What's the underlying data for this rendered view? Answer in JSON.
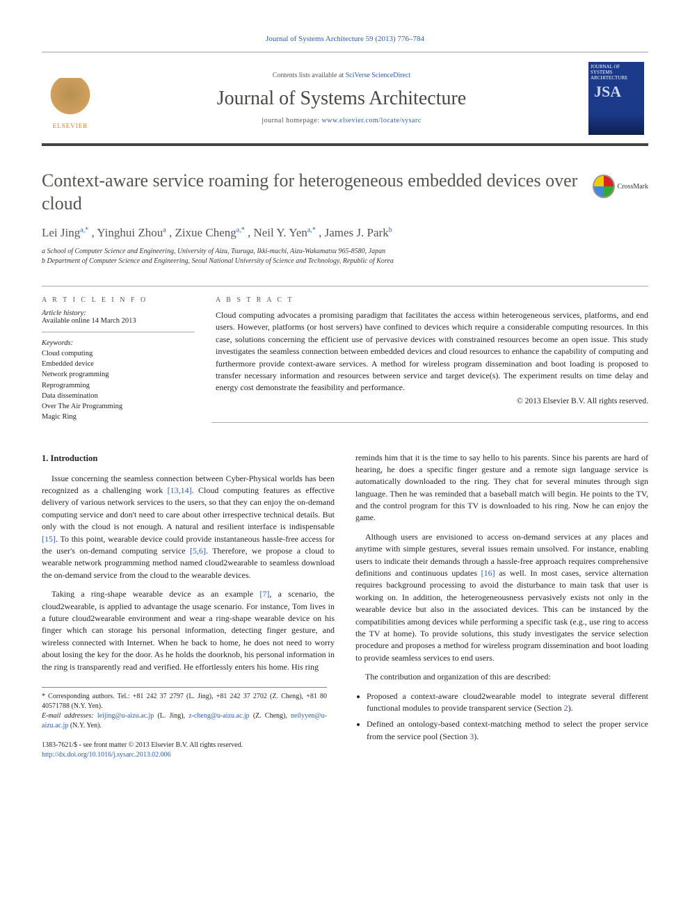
{
  "header": {
    "citation": "Journal of Systems Architecture 59 (2013) 776–784",
    "contents_prefix": "Contents lists available at ",
    "contents_link": "SciVerse ScienceDirect",
    "journal_title": "Journal of Systems Architecture",
    "homepage_prefix": "journal homepage: ",
    "homepage_link": "www.elsevier.com/locate/sysarc",
    "publisher": "ELSEVIER",
    "cover_small": "JOURNAL OF SYSTEMS ARCHITECTURE",
    "cover_big": "JSA"
  },
  "title": "Context-aware service roaming for heterogeneous embedded devices over cloud",
  "crossmark": "CrossMark",
  "authors_html": "Lei Jing",
  "authors": {
    "a1_name": "Lei Jing",
    "a1_sup": "a,*",
    "a2_name": ", Yinghui Zhou",
    "a2_sup": "a",
    "a3_name": ", Zixue Cheng",
    "a3_sup": "a,*",
    "a4_name": ", Neil Y. Yen",
    "a4_sup": "a,*",
    "a5_name": ", James J. Park",
    "a5_sup": "b"
  },
  "affiliations": {
    "a": "a School of Computer Science and Engineering, University of Aizu, Tsuruga, Ikki-machi, Aizu-Wakamatsu 965-8580, Japan",
    "b": "b Department of Computer Science and Engineering, Seoul National University of Science and Technology, Republic of Korea"
  },
  "info": {
    "label": "A R T I C L E   I N F O",
    "history_label": "Article history:",
    "history_line": "Available online 14 March 2013",
    "keywords_label": "Keywords:",
    "keywords": [
      "Cloud computing",
      "Embedded device",
      "Network programming",
      "Reprogramming",
      "Data dissemination",
      "Over The Air Programming",
      "Magic Ring"
    ]
  },
  "abstract": {
    "label": "A B S T R A C T",
    "text": "Cloud computing advocates a promising paradigm that facilitates the access within heterogeneous services, platforms, and end users. However, platforms (or host servers) have confined to devices which require a considerable computing resources. In this case, solutions concerning the efficient use of pervasive devices with constrained resources become an open issue. This study investigates the seamless connection between embedded devices and cloud resources to enhance the capability of computing and furthermore provide context-aware services. A method for wireless program dissemination and boot loading is proposed to transfer necessary information and resources between service and target device(s). The experiment results on time delay and energy cost demonstrate the feasibility and performance.",
    "copyright": "© 2013 Elsevier B.V. All rights reserved."
  },
  "body": {
    "sec1_heading": "1. Introduction",
    "col1_p1_a": "Issue concerning the seamless connection between Cyber-Physical worlds has been recognized as a challenging work ",
    "col1_p1_ref1": "[13,14]",
    "col1_p1_b": ". Cloud computing features as effective delivery of various network services to the users, so that they can enjoy the on-demand computing service and don't need to care about other irrespective technical details. But only with the cloud is not enough. A natural and resilient interface is indispensable ",
    "col1_p1_ref2": "[15]",
    "col1_p1_c": ". To this point, wearable device could provide instantaneous hassle-free access for the user's on-demand computing service ",
    "col1_p1_ref3": "[5,6]",
    "col1_p1_d": ". Therefore, we propose a cloud to wearable network programming method named cloud2wearable to seamless download the on-demand service from the cloud to the wearable devices.",
    "col1_p2_a": "Taking a ring-shape wearable device as an example ",
    "col1_p2_ref1": "[7]",
    "col1_p2_b": ", a scenario, the cloud2wearable, is applied to advantage the usage scenario. For instance, Tom lives in a future cloud2wearable environment and wear a ring-shape wearable device on his finger which can storage his personal information, detecting finger gesture, and wireless connected with Internet. When he back to home, he does not need to worry about losing the key for the door. As he holds the doorknob, his personal information in the ring is transparently read and verified. He effortlessly enters his home. His ring",
    "col2_p1": "reminds him that it is the time to say hello to his parents. Since his parents are hard of hearing, he does a specific finger gesture and a remote sign language service is automatically downloaded to the ring. They chat for several minutes through sign language. Then he was reminded that a baseball match will begin. He points to the TV, and the control program for this TV is downloaded to his ring. Now he can enjoy the game.",
    "col2_p2_a": "Although users are envisioned to access on-demand services at any places and anytime with simple gestures, several issues remain unsolved. For instance, enabling users to indicate their demands through a hassle-free approach requires comprehensive definitions and continuous updates ",
    "col2_p2_ref1": "[16]",
    "col2_p2_b": " as well. In most cases, service alternation requires background processing to avoid the disturbance to main task that user is working on. In addition, the heterogeneousness pervasively exists not only in the wearable device but also in the associated devices. This can be instanced by the compatibilities among devices while performing a specific task (e.g., use ring to access the TV at home). To provide solutions, this study investigates the service selection procedure and proposes a method for wireless program dissemination and boot loading to provide seamless services to end users.",
    "col2_p3": "The contribution and organization of this are described:",
    "bullets": [
      {
        "pre": "Proposed a context-aware cloud2wearable model to integrate several different functional modules to provide transparent service (Section ",
        "ref": "2",
        "post": ")."
      },
      {
        "pre": "Defined an ontology-based context-matching method to select the proper service from the service pool (Section ",
        "ref": "3",
        "post": ")."
      }
    ]
  },
  "footnotes": {
    "corr": "* Corresponding authors. Tel.: +81 242 37 2797 (L. Jing), +81 242 37 2702 (Z. Cheng), +81 80 40571788 (N.Y. Yen).",
    "emails_label": "E-mail addresses: ",
    "e1": "leijing@u-aizu.ac.jp",
    "e1_who": " (L. Jing), ",
    "e2": "z-cheng@u-aizu.ac.jp",
    "e2_who": " (Z. Cheng), ",
    "e3": "neilyyen@u-aizu.ac.jp",
    "e3_who": " (N.Y. Yen)."
  },
  "footer": {
    "issn": "1383-7621/$ - see front matter © 2013 Elsevier B.V. All rights reserved.",
    "doi": "http://dx.doi.org/10.1016/j.sysarc.2013.02.006"
  }
}
